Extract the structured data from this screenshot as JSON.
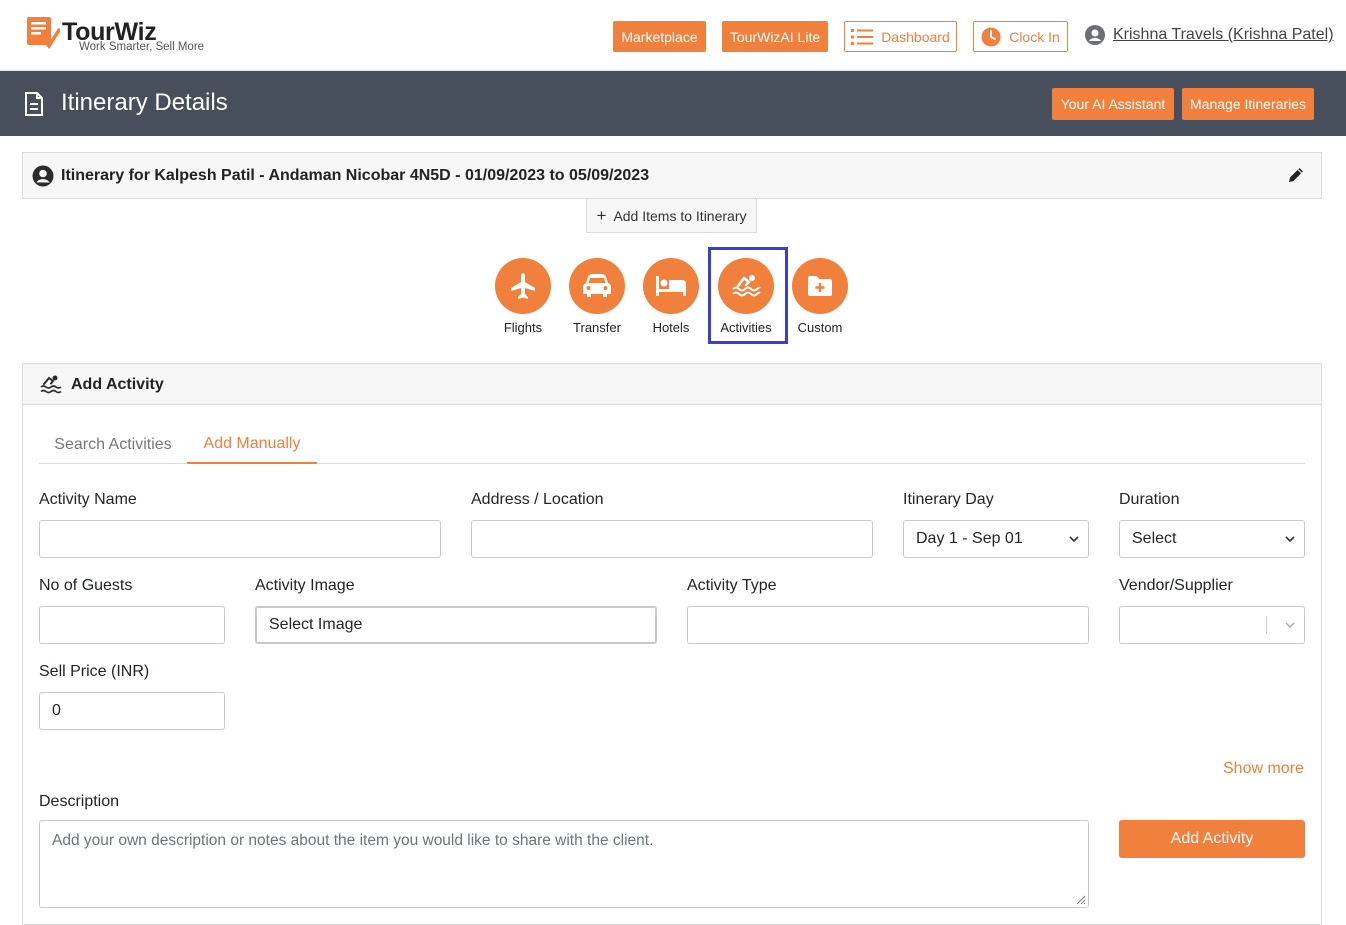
{
  "header": {
    "logo_name": "TourWiz",
    "logo_tagline": "Work Smarter, Sell More",
    "marketplace_label": "Marketplace",
    "tourwizai_label": "TourWizAI Lite",
    "dashboard_label": "Dashboard",
    "clockin_label": "Clock In",
    "user_name": "Krishna Travels (Krishna Patel)"
  },
  "titlebar": {
    "title": "Itinerary Details",
    "ai_assistant_label": "Your AI Assistant",
    "manage_itineraries_label": "Manage Itineraries"
  },
  "itinerary": {
    "title": "Itinerary for Kalpesh Patil - Andaman Nicobar 4N5D - 01/09/2023 to 05/09/2023",
    "add_items_label": "Add Items to Itinerary"
  },
  "categories": [
    {
      "label": "Flights",
      "icon": "plane-icon"
    },
    {
      "label": "Transfer",
      "icon": "car-icon"
    },
    {
      "label": "Hotels",
      "icon": "bed-icon"
    },
    {
      "label": "Activities",
      "icon": "swimmer-icon"
    },
    {
      "label": "Custom",
      "icon": "folder-plus-icon"
    }
  ],
  "add_activity": {
    "heading": "Add Activity",
    "tabs": [
      "Search Activities",
      "Add Manually"
    ],
    "active_tab": "Add Manually",
    "fields": {
      "activity_name_label": "Activity Name",
      "activity_name_value": "",
      "address_label": "Address / Location",
      "address_value": "",
      "itinerary_day_label": "Itinerary Day",
      "itinerary_day_value": "Day 1 - Sep 01",
      "duration_label": "Duration",
      "duration_value": "Select",
      "guests_label": "No of Guests",
      "guests_value": "",
      "image_label": "Activity Image",
      "image_value": "Select Image",
      "type_label": "Activity Type",
      "type_value": "",
      "vendor_label": "Vendor/Supplier",
      "vendor_value": "",
      "sell_price_label": "Sell Price (INR)",
      "sell_price_value": "0"
    },
    "show_more_label": "Show more",
    "description_label": "Description",
    "description_placeholder": "Add your own description or notes about the item you would like to share with the client.",
    "add_button_label": "Add Activity"
  },
  "colors": {
    "accent": "#f0803c",
    "titlebar_bg": "#474e5c",
    "highlight": "#3b3fcf"
  }
}
